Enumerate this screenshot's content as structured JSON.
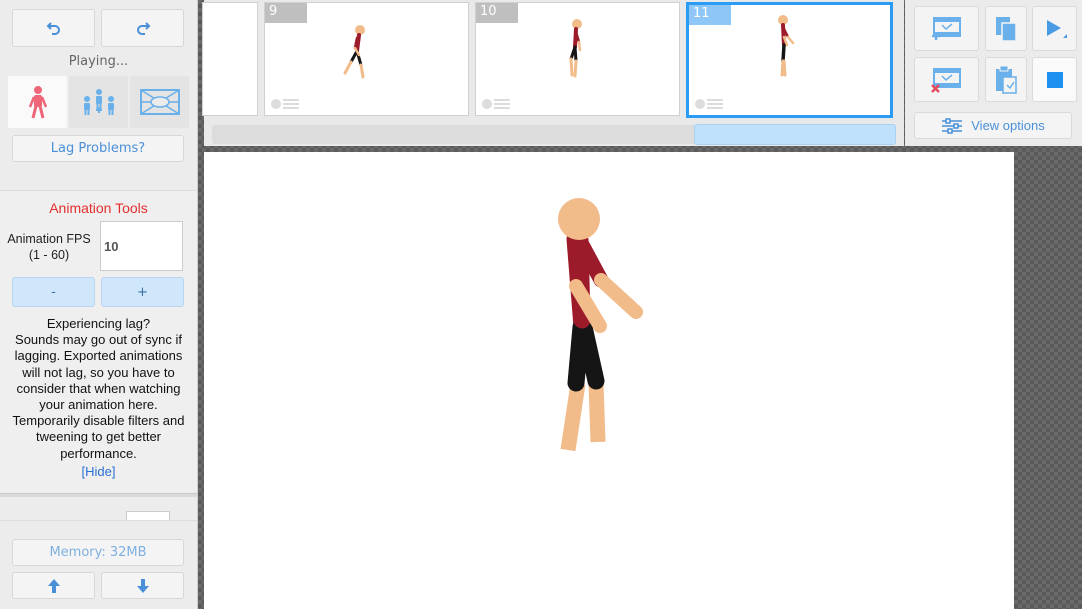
{
  "left_panel": {
    "undo_icon": "undo-arrow",
    "redo_icon": "redo-arrow",
    "status": "Playing...",
    "tool_tabs": [
      "single-figure-icon",
      "group-figures-icon",
      "background-image-icon"
    ],
    "lag_button": "Lag Problems?",
    "animation_tools": {
      "title": "Animation Tools",
      "fps_label_line1": "Animation FPS",
      "fps_label_line2": "(1 - 60)",
      "fps_value": "10",
      "minus_label": "-",
      "plus_label": "+",
      "lag_title": "Experiencing lag?",
      "lag_body": "Sounds may go out of sync if lagging. Exported animations will not lag, so you have to consider that when watching your animation here. Temporarily disable filters and tweening to get better performance.",
      "hide_link": "[Hide]"
    },
    "memory_label": "Memory: 32MB"
  },
  "timeline": {
    "frames": [
      {
        "number": "9",
        "selected": false
      },
      {
        "number": "10",
        "selected": false
      },
      {
        "number": "11",
        "selected": true
      }
    ]
  },
  "right_panel": {
    "view_options_label": "View options",
    "icons": [
      "add-frame-icon",
      "copy-frame-icon",
      "play-icon",
      "delete-frame-icon",
      "paste-frame-icon",
      "stop-icon"
    ]
  },
  "colors": {
    "accent_blue": "#2b9cf6",
    "figure_skin": "#f2bb8a",
    "figure_shirt": "#9c1b2a",
    "figure_pants": "#151515",
    "title_red": "#e3302f"
  }
}
